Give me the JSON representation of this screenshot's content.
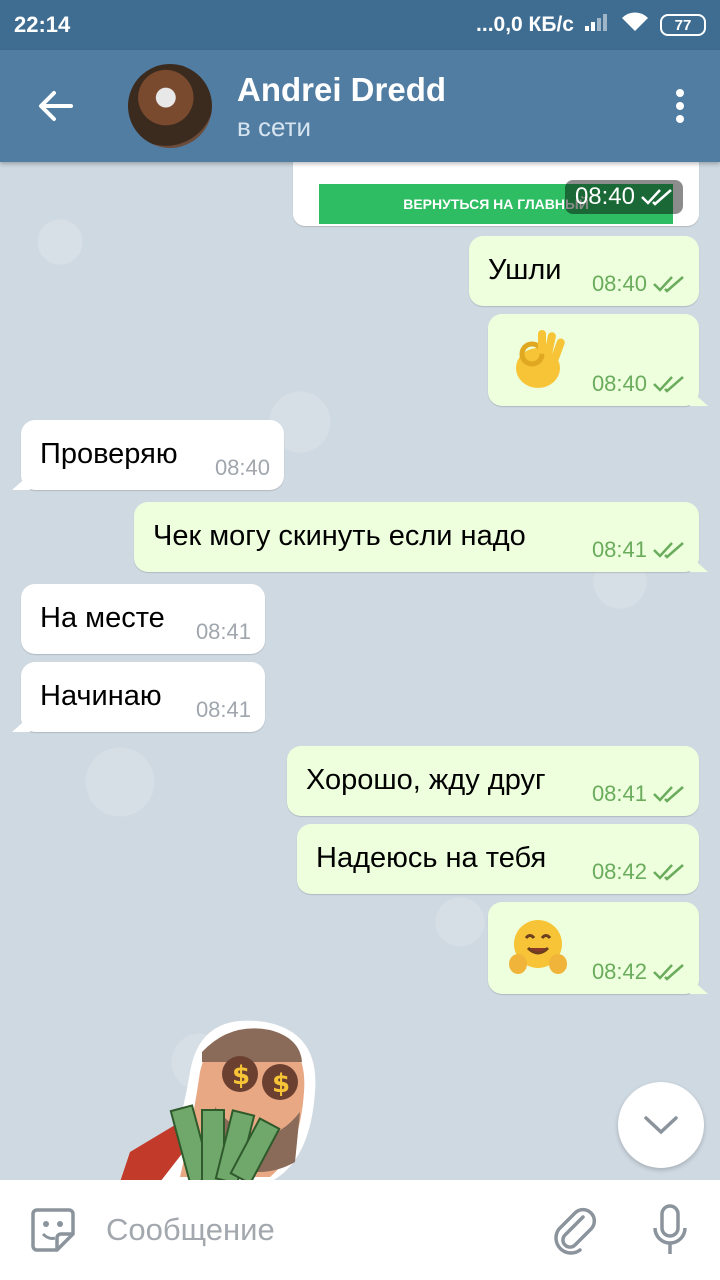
{
  "status_bar": {
    "time": "22:14",
    "network_speed": "...0,0 КБ/с",
    "battery": "77"
  },
  "header": {
    "contact_name": "Andrei Dredd",
    "contact_status": "в сети"
  },
  "top_card": {
    "button_label": "ВЕРНУТЬСЯ НА ГЛАВНЫЙ",
    "time": "08:40"
  },
  "messages": [
    {
      "direction": "out",
      "text": "Ушли",
      "time": "08:40",
      "read": true
    },
    {
      "direction": "out",
      "emoji": "ok-hand",
      "time": "08:40",
      "read": true
    },
    {
      "direction": "in",
      "text": "Проверяю",
      "time": "08:40"
    },
    {
      "direction": "out",
      "text": "Чек могу скинуть если надо",
      "time": "08:41",
      "read": true
    },
    {
      "direction": "in",
      "text": "На месте",
      "time": "08:41"
    },
    {
      "direction": "in",
      "text": "Начинаю",
      "time": "08:41"
    },
    {
      "direction": "out",
      "text": "Хорошо, жду друг",
      "time": "08:41",
      "read": true
    },
    {
      "direction": "out",
      "text": "Надеюсь на тебя",
      "time": "08:42",
      "read": true
    },
    {
      "direction": "out",
      "emoji": "hugging-face",
      "time": "08:42",
      "read": true
    }
  ],
  "input": {
    "placeholder": "Сообщение"
  },
  "colors": {
    "header": "#517da2",
    "status_bar": "#3f6d92",
    "outgoing_bubble": "#eeffde",
    "incoming_bubble": "#ffffff",
    "read_check": "#6aac5c"
  },
  "icons": [
    "back-arrow-icon",
    "more-vert-icon",
    "double-check-icon",
    "chevron-down-icon",
    "sticker-icon",
    "paperclip-icon",
    "microphone-icon",
    "wifi-icon",
    "signal-icon"
  ]
}
